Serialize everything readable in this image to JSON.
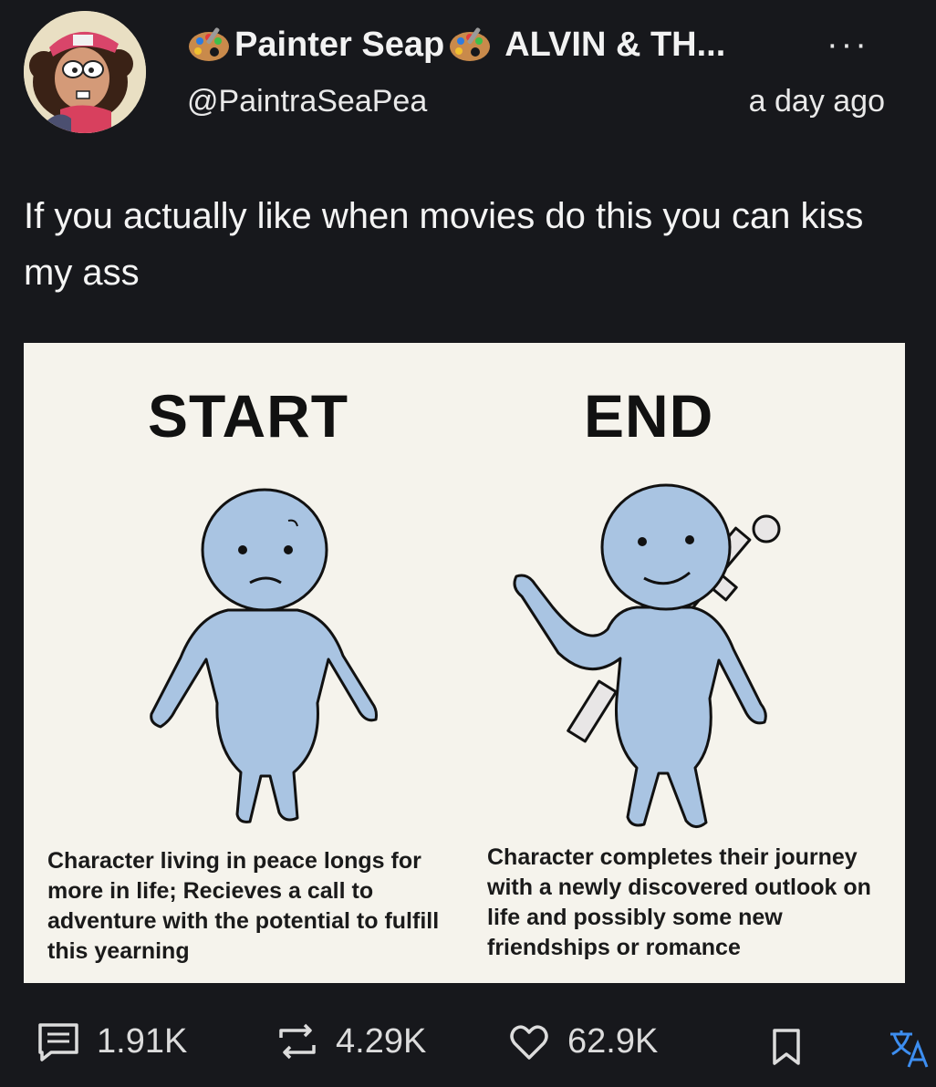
{
  "post": {
    "author": {
      "display_name_1": "Painter Seap",
      "display_name_2": "ALVIN & TH...",
      "handle": "@PaintraSeaPea",
      "avatar_icon": "cartoon-avatar-icon",
      "name_emoji": "artist-palette"
    },
    "timestamp": "a day ago",
    "more_icon": "more-options-icon",
    "text": "If you actually like when movies do this you can kiss my ass",
    "image": {
      "left_title": "START",
      "right_title": "END",
      "left_caption": "Character living in peace longs for more in life; Recieves a call to adventure with the potential to fulfill this yearning",
      "right_caption": "Character completes their journey with a newly discovered outlook on life and possibly some new friendships or romance",
      "figure_color": "#a9c4e2"
    },
    "actions": {
      "comments": "1.91K",
      "reposts": "4.29K",
      "likes": "62.9K",
      "bookmark_icon": "bookmark-icon",
      "translate_icon": "translate-icon"
    }
  },
  "colors": {
    "background": "#17181c",
    "card": "#f5f3ec",
    "translate_accent": "#3d8ef0"
  }
}
